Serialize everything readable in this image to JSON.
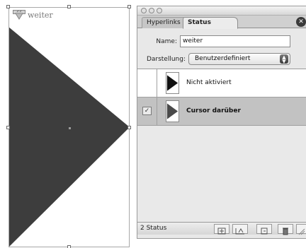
{
  "canvas": {
    "object_label": "weiter",
    "shape_color": "#3d3d3d",
    "icon": "button-symbol-icon"
  },
  "panel": {
    "tabs": [
      {
        "label": "Hyperlinks",
        "active": false
      },
      {
        "label": "Status",
        "active": true
      }
    ],
    "close_icon": "close-icon",
    "name_label": "Name:",
    "name_value": "weiter",
    "display_label": "Darstellung:",
    "display_value": "Benutzerdefiniert",
    "states": [
      {
        "label": "Nicht aktiviert",
        "checked": false,
        "selected": false,
        "thumb_fill": "#111111"
      },
      {
        "label": "Cursor darüber",
        "checked": true,
        "selected": true,
        "thumb_fill": "#4a4a4a"
      }
    ],
    "footer": {
      "count_text": "2 Status",
      "buttons": [
        "convert-icon",
        "content-icon",
        "new-state-icon",
        "delete-icon"
      ]
    }
  }
}
